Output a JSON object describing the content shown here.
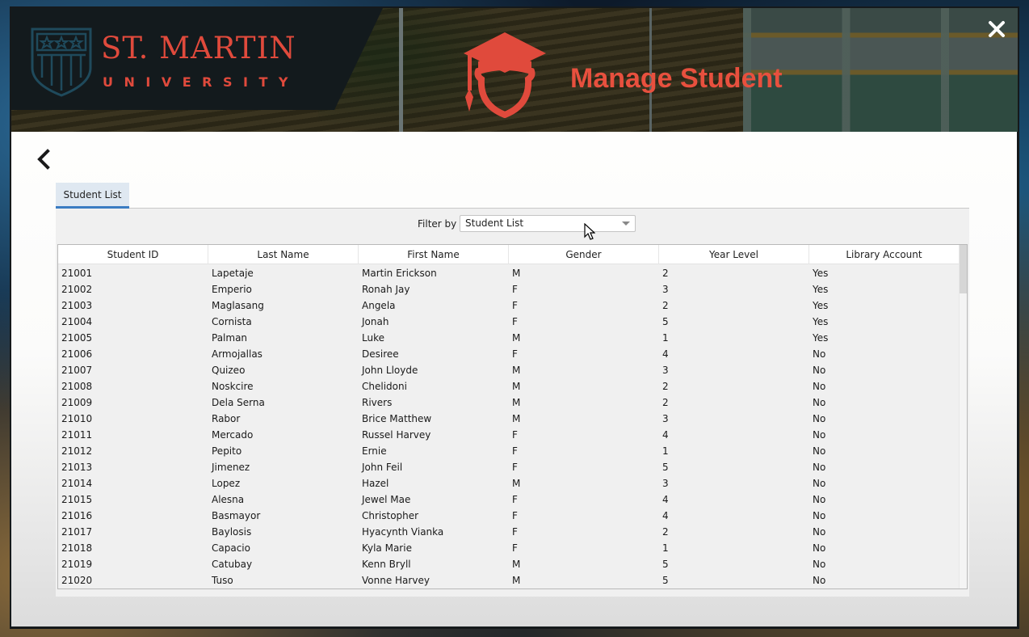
{
  "header": {
    "brand_name": "ST. MARTIN",
    "brand_sub": "UNIVERSITY",
    "page_title": "Manage Student",
    "close_icon": "close-icon",
    "logo_icon": "shield-icon",
    "page_icon": "graduate-student-icon"
  },
  "nav": {
    "back_icon": "chevron-left-icon"
  },
  "tabs": [
    {
      "label": "Student List",
      "active": true
    }
  ],
  "filter": {
    "label": "Filter by",
    "selected": "Student List"
  },
  "table": {
    "columns": [
      "Student ID",
      "Last Name",
      "First Name",
      "Gender",
      "Year Level",
      "Library Account"
    ],
    "rows": [
      [
        "21001",
        "Lapetaje",
        "Martin Erickson",
        "M",
        "2",
        "Yes"
      ],
      [
        "21002",
        "Emperio",
        "Ronah Jay",
        "F",
        "3",
        "Yes"
      ],
      [
        "21003",
        "Maglasang",
        "Angela",
        "F",
        "2",
        "Yes"
      ],
      [
        "21004",
        "Cornista",
        "Jonah",
        "F",
        "5",
        "Yes"
      ],
      [
        "21005",
        "Palman",
        "Luke",
        "M",
        "1",
        "Yes"
      ],
      [
        "21006",
        "Armojallas",
        "Desiree",
        "F",
        "4",
        "No"
      ],
      [
        "21007",
        "Quizeo",
        "John Lloyde",
        "M",
        "3",
        "No"
      ],
      [
        "21008",
        "Noskcire",
        "Chelidoni",
        "M",
        "2",
        "No"
      ],
      [
        "21009",
        "Dela Serna",
        "Rivers",
        "M",
        "2",
        "No"
      ],
      [
        "21010",
        "Rabor",
        "Brice Matthew",
        "M",
        "3",
        "No"
      ],
      [
        "21011",
        "Mercado",
        "Russel Harvey",
        "F",
        "4",
        "No"
      ],
      [
        "21012",
        "Pepito",
        "Ernie",
        "F",
        "1",
        "No"
      ],
      [
        "21013",
        "Jimenez",
        "John Feil",
        "F",
        "5",
        "No"
      ],
      [
        "21014",
        "Lopez",
        "Hazel",
        "M",
        "3",
        "No"
      ],
      [
        "21015",
        "Alesna",
        "Jewel Mae",
        "F",
        "4",
        "No"
      ],
      [
        "21016",
        "Basmayor",
        "Christopher",
        "F",
        "4",
        "No"
      ],
      [
        "21017",
        "Baylosis",
        "Hyacynth Vianka",
        "F",
        "2",
        "No"
      ],
      [
        "21018",
        "Capacio",
        "Kyla Marie",
        "F",
        "1",
        "No"
      ],
      [
        "21019",
        "Catubay",
        "Kenn Bryll",
        "M",
        "5",
        "No"
      ],
      [
        "21020",
        "Tuso",
        "Vonne Harvey",
        "M",
        "5",
        "No"
      ]
    ]
  },
  "colors": {
    "accent": "#e04a3c",
    "tab_underline": "#3a7cc2",
    "shield": "#1f4a5c"
  }
}
